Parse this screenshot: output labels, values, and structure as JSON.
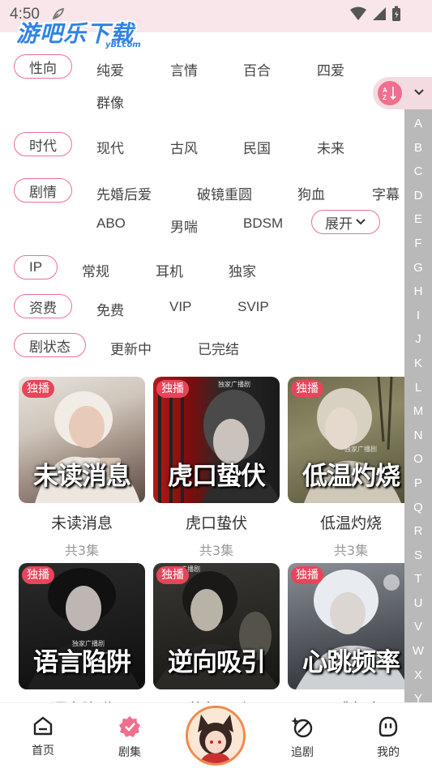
{
  "status": {
    "time": "4:50"
  },
  "watermark": {
    "text": "游吧乐下载",
    "sub": "yBLcom"
  },
  "filters": {
    "orientation": {
      "label": "性向",
      "options": [
        "纯爱",
        "言情",
        "百合",
        "四爱",
        "群像"
      ]
    },
    "era": {
      "label": "时代",
      "options": [
        "现代",
        "古风",
        "民国",
        "未来"
      ]
    },
    "plot": {
      "label": "剧情",
      "options": [
        "先婚后爱",
        "破镜重圆",
        "狗血",
        "字幕",
        "ABO",
        "男喘",
        "BDSM"
      ],
      "expand": "展开"
    },
    "ip": {
      "label": "IP",
      "options": [
        "常规",
        "耳机",
        "独家"
      ]
    },
    "fee": {
      "label": "资费",
      "options": [
        "免费",
        "VIP",
        "SVIP"
      ]
    },
    "state": {
      "label": "剧状态",
      "options": [
        "更新中",
        "已完结"
      ]
    }
  },
  "alphabet": [
    "A",
    "B",
    "C",
    "D",
    "E",
    "F",
    "G",
    "H",
    "I",
    "J",
    "K",
    "L",
    "M",
    "N",
    "O",
    "P",
    "Q",
    "R",
    "S",
    "T",
    "U",
    "V",
    "W",
    "X",
    "Y"
  ],
  "cards": [
    {
      "badge": "独播",
      "cover_text": "未读消息",
      "title": "未读消息",
      "count": "共3集",
      "tag": ""
    },
    {
      "badge": "独播",
      "cover_text": "虎口蛰伏",
      "title": "虎口蛰伏",
      "count": "共3集",
      "tag": "独家广播剧"
    },
    {
      "badge": "独播",
      "cover_text": "低温灼烧",
      "title": "低温灼烧",
      "count": "共3集",
      "tag": "独家广播剧"
    },
    {
      "badge": "独播",
      "cover_text": "语言陷阱",
      "title": "语言陷阱",
      "count": "",
      "tag": "独家广播剧"
    },
    {
      "badge": "独播",
      "cover_text": "逆向吸引",
      "title": "逆向吸引",
      "count": "",
      "tag": "广播剧"
    },
    {
      "badge": "独播",
      "cover_text": "心跳频率",
      "title": "心跳频率",
      "count": "",
      "tag": ""
    }
  ],
  "nav": {
    "home": "首页",
    "drama": "剧集",
    "follow": "追剧",
    "mine": "我的"
  },
  "colors": {
    "accent": "#ef6f8e",
    "badge": "#e8445a",
    "sidebar": "#b9b9b9"
  }
}
